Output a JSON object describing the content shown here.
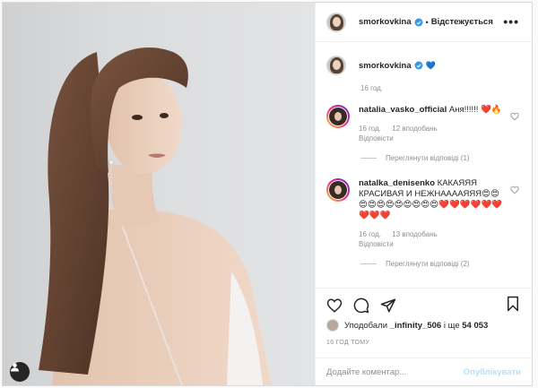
{
  "post": {
    "author": "smorkovkina",
    "follow_state": "Відстежується",
    "more_label": "•••",
    "caption_time": "16 год.",
    "caption_emoji": "💙"
  },
  "comments": [
    {
      "username": "natalia_vasko_official",
      "text": "Аня!!!!!! ❤️🔥",
      "time": "16 год.",
      "likes": "12 вподобань",
      "reply": "Відповісти",
      "view_replies": "Переглянути відповіді (1)"
    },
    {
      "username": "natalka_denisenko",
      "text": "КАКАЯЯЯ КРАСИВАЯ И НЕЖНААААЯЯЯ😍😍😍😍😍😍😍😍😍😍😍❤️❤️❤️❤️❤️❤️❤️❤️❤️",
      "time": "16 год.",
      "likes": "13 вподобань",
      "reply": "Відповісти",
      "view_replies": "Переглянути відповіді (2)"
    }
  ],
  "likes": {
    "prefix": "Уподобали",
    "user": "_infinity_506",
    "middle": "і ще",
    "count": "54 053"
  },
  "timestamp": "16 ГОД ТОМУ",
  "composer": {
    "placeholder": "Додайте коментар...",
    "publish": "Опублікувати"
  },
  "icons": [
    "heart-icon",
    "comment-icon",
    "share-icon",
    "bookmark-icon",
    "verified-badge-icon",
    "user-tag-icon"
  ],
  "colors": {
    "verified": "#3897f0",
    "publish_disabled": "#b2dffc",
    "muted": "#8e8e8e"
  }
}
